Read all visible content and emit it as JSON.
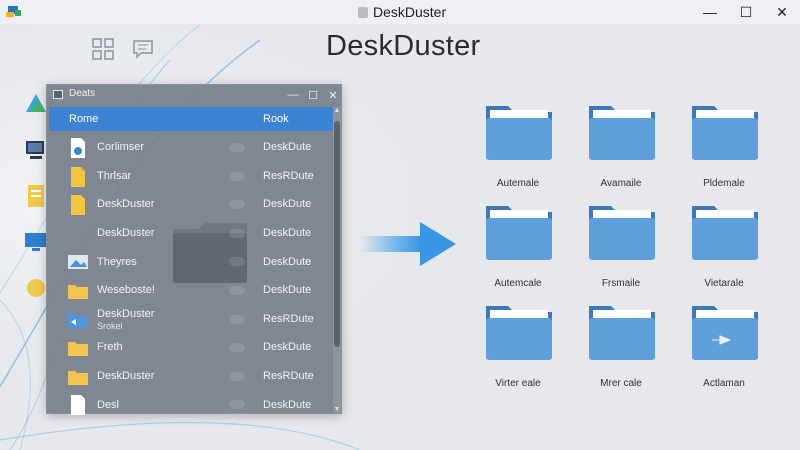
{
  "window": {
    "title": "DeskDuster",
    "controls": {
      "minimize": "—",
      "maximize": "☐",
      "close": "✕"
    }
  },
  "app_title": "DeskDuster",
  "explorer": {
    "title": "Deats",
    "controls": {
      "minimize": "—",
      "maximize": "☐",
      "close": "✕"
    },
    "header": {
      "name": "Rome",
      "location": "Rook"
    },
    "rows": [
      {
        "name": "Corlimser",
        "location": "DeskDute",
        "icon": "document-icon"
      },
      {
        "name": "Thrlsar",
        "location": "ResRDute",
        "icon": "document-icon"
      },
      {
        "name": "DeskDuster",
        "location": "DeskDute",
        "icon": "document-icon"
      },
      {
        "name": "DeskDuster",
        "location": "DeskDute",
        "icon": "blank-icon"
      },
      {
        "name": "Theyres",
        "location": "DeskDute",
        "icon": "image-icon"
      },
      {
        "name": "Weseboste!",
        "location": "DeskDute",
        "icon": "folder-icon"
      },
      {
        "name": "DeskDuster",
        "sub": "Srokel",
        "location": "ResRDute",
        "icon": "blue-folder-icon"
      },
      {
        "name": "Freth",
        "location": "DeskDute",
        "icon": "folder-icon"
      },
      {
        "name": "DeskDuster",
        "location": "ResRDute",
        "icon": "folder-icon"
      },
      {
        "name": "Desl",
        "location": "DeskDute",
        "icon": "document-icon"
      }
    ]
  },
  "folders": [
    {
      "label": "Autemale"
    },
    {
      "label": "Avamaile"
    },
    {
      "label": "Pldemale"
    },
    {
      "label": "Autemcale"
    },
    {
      "label": "Frsmaile"
    },
    {
      "label": "Vietarale"
    },
    {
      "label": "Virter eale"
    },
    {
      "label": "Mrer cale"
    },
    {
      "label": "Actlaman"
    }
  ],
  "colors": {
    "accent": "#3d83d4",
    "folder_body": "#5fa0dc",
    "folder_tab": "#3f78b8",
    "explorer_bg": "#76808a"
  }
}
